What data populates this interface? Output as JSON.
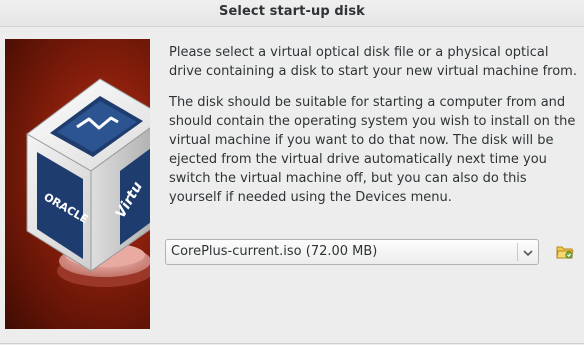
{
  "window": {
    "title": "Select start-up disk"
  },
  "banner": {
    "logo_text_front": "ORACLE",
    "logo_text_side": "Virtu"
  },
  "description": {
    "paragraph1": "Please select a virtual optical disk file or a physical optical drive containing a disk to start your new virtual machine from.",
    "paragraph2": "The disk should be suitable for starting a computer from and should contain the operating system you wish to install on the virtual machine if you want to do that now. The disk will be ejected from the virtual drive automatically next time you switch the virtual machine off, but you can also do this yourself if needed using the Devices menu."
  },
  "disk_selector": {
    "selected_value": "CorePlus-current.iso (72.00 MB)"
  },
  "icons": {
    "dropdown": "chevron-down-icon",
    "browse": "folder-icon"
  },
  "colors": {
    "banner_red": "#8a1f0c",
    "cube_blue": "#1f3c6e",
    "folder_green": "#7cb342",
    "folder_yellow": "#f2c94c"
  }
}
